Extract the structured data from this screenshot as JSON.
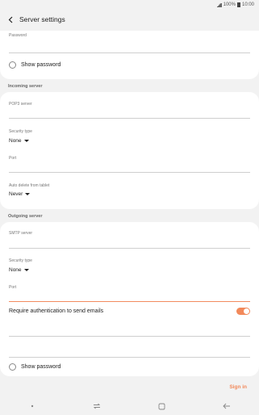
{
  "status_bar": {
    "signal": "ıl",
    "battery": "100%",
    "time": "10:00"
  },
  "header": {
    "title": "Server settings"
  },
  "account": {
    "password_label": "Password",
    "show_password_label": "Show password"
  },
  "incoming": {
    "section_title": "Incoming server",
    "pop3_label": "POP3 server",
    "security_type_label": "Security type",
    "security_type_value": "None",
    "port_label": "Port",
    "auto_delete_label": "Auto delete from tablet",
    "auto_delete_value": "Never"
  },
  "outgoing": {
    "section_title": "Outgoing server",
    "smtp_label": "SMTP server",
    "security_type_label": "Security type",
    "security_type_value": "None",
    "port_label": "Port",
    "require_auth_label": "Require authentication to send emails",
    "require_auth_on": true,
    "show_password_label": "Show password"
  },
  "actions": {
    "sign_in": "Sign in"
  },
  "colors": {
    "accent": "#f2895a",
    "background": "#f2f2f2",
    "card": "#ffffff"
  }
}
